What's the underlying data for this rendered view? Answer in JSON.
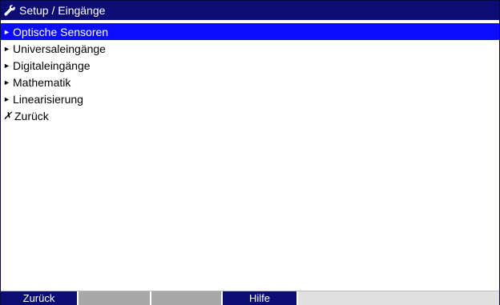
{
  "titlebar": {
    "icon": "wrench-icon",
    "title": "Setup / Eingänge"
  },
  "menu": {
    "items": [
      {
        "marker": "►",
        "label": "Optische Sensoren",
        "selected": true
      },
      {
        "marker": "►",
        "label": "Universaleingänge",
        "selected": false
      },
      {
        "marker": "►",
        "label": "Digitaleingänge",
        "selected": false
      },
      {
        "marker": "►",
        "label": "Mathematik",
        "selected": false
      },
      {
        "marker": "►",
        "label": "Linearisierung",
        "selected": false
      },
      {
        "marker": "✗",
        "label": "Zurück",
        "selected": false
      }
    ]
  },
  "softkeys": [
    {
      "label": "Zurück"
    },
    {
      "label": ""
    },
    {
      "label": ""
    },
    {
      "label": "Hilfe"
    }
  ],
  "colors": {
    "title_bg": "#0c0c74",
    "selected_bg": "#0b0bff",
    "softkey_bg": "#0c0c74",
    "softkey_empty": "#a8a8a8"
  }
}
